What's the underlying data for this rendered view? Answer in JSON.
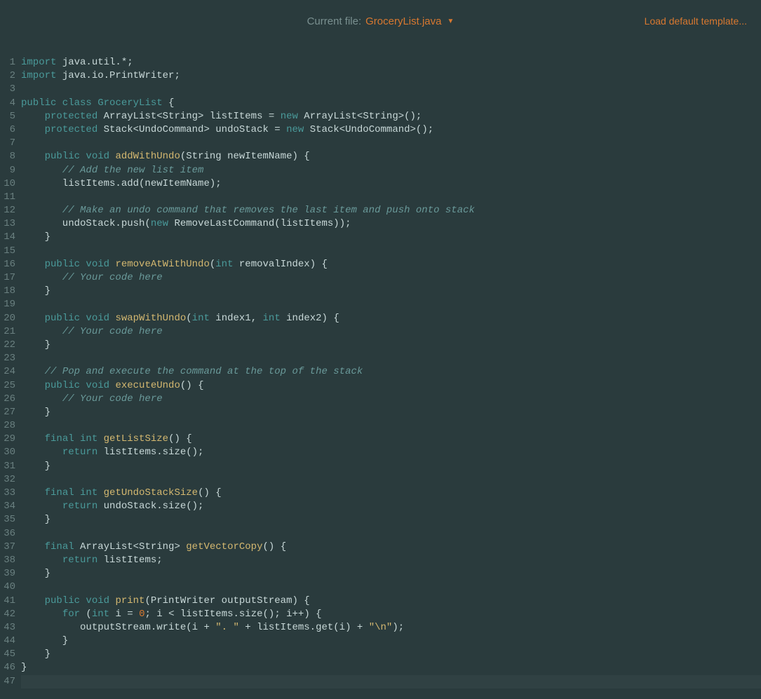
{
  "header": {
    "currentFileLabel": "Current file:",
    "currentFileName": "GroceryList.java",
    "loadTemplate": "Load default template..."
  },
  "code": {
    "lines": [
      [
        {
          "t": "import",
          "c": "kw"
        },
        {
          "t": " java.util.*;",
          "c": "plain"
        }
      ],
      [
        {
          "t": "import",
          "c": "kw"
        },
        {
          "t": " java.io.PrintWriter;",
          "c": "plain"
        }
      ],
      [],
      [
        {
          "t": "public class",
          "c": "kw"
        },
        {
          "t": " ",
          "c": "plain"
        },
        {
          "t": "GroceryList",
          "c": "type"
        },
        {
          "t": " {",
          "c": "plain"
        }
      ],
      [
        {
          "t": "    ",
          "c": "plain"
        },
        {
          "t": "protected",
          "c": "kw"
        },
        {
          "t": " ArrayList<String> listItems = ",
          "c": "plain"
        },
        {
          "t": "new",
          "c": "kw"
        },
        {
          "t": " ArrayList<String>();",
          "c": "plain"
        }
      ],
      [
        {
          "t": "    ",
          "c": "plain"
        },
        {
          "t": "protected",
          "c": "kw"
        },
        {
          "t": " Stack<UndoCommand> undoStack = ",
          "c": "plain"
        },
        {
          "t": "new",
          "c": "kw"
        },
        {
          "t": " Stack<UndoCommand>();",
          "c": "plain"
        }
      ],
      [],
      [
        {
          "t": "    ",
          "c": "plain"
        },
        {
          "t": "public void",
          "c": "kw"
        },
        {
          "t": " ",
          "c": "plain"
        },
        {
          "t": "addWithUndo",
          "c": "method"
        },
        {
          "t": "(String newItemName) {",
          "c": "plain"
        }
      ],
      [
        {
          "t": "       ",
          "c": "plain"
        },
        {
          "t": "// Add the new list item",
          "c": "comment"
        }
      ],
      [
        {
          "t": "       listItems.add(newItemName);",
          "c": "plain"
        }
      ],
      [],
      [
        {
          "t": "       ",
          "c": "plain"
        },
        {
          "t": "// Make an undo command that removes the last item and push onto stack",
          "c": "comment"
        }
      ],
      [
        {
          "t": "       undoStack.push(",
          "c": "plain"
        },
        {
          "t": "new",
          "c": "kw"
        },
        {
          "t": " RemoveLastCommand(listItems));",
          "c": "plain"
        }
      ],
      [
        {
          "t": "    }",
          "c": "plain"
        }
      ],
      [],
      [
        {
          "t": "    ",
          "c": "plain"
        },
        {
          "t": "public void",
          "c": "kw"
        },
        {
          "t": " ",
          "c": "plain"
        },
        {
          "t": "removeAtWithUndo",
          "c": "method"
        },
        {
          "t": "(",
          "c": "plain"
        },
        {
          "t": "int",
          "c": "kw"
        },
        {
          "t": " removalIndex) {",
          "c": "plain"
        }
      ],
      [
        {
          "t": "       ",
          "c": "plain"
        },
        {
          "t": "// Your code here",
          "c": "comment"
        }
      ],
      [
        {
          "t": "    }",
          "c": "plain"
        }
      ],
      [],
      [
        {
          "t": "    ",
          "c": "plain"
        },
        {
          "t": "public void",
          "c": "kw"
        },
        {
          "t": " ",
          "c": "plain"
        },
        {
          "t": "swapWithUndo",
          "c": "method"
        },
        {
          "t": "(",
          "c": "plain"
        },
        {
          "t": "int",
          "c": "kw"
        },
        {
          "t": " index1, ",
          "c": "plain"
        },
        {
          "t": "int",
          "c": "kw"
        },
        {
          "t": " index2) {",
          "c": "plain"
        }
      ],
      [
        {
          "t": "       ",
          "c": "plain"
        },
        {
          "t": "// Your code here",
          "c": "comment"
        }
      ],
      [
        {
          "t": "    }",
          "c": "plain"
        }
      ],
      [],
      [
        {
          "t": "    ",
          "c": "plain"
        },
        {
          "t": "// Pop and execute the command at the top of the stack",
          "c": "comment"
        }
      ],
      [
        {
          "t": "    ",
          "c": "plain"
        },
        {
          "t": "public void",
          "c": "kw"
        },
        {
          "t": " ",
          "c": "plain"
        },
        {
          "t": "executeUndo",
          "c": "method"
        },
        {
          "t": "() {",
          "c": "plain"
        }
      ],
      [
        {
          "t": "       ",
          "c": "plain"
        },
        {
          "t": "// Your code here",
          "c": "comment"
        }
      ],
      [
        {
          "t": "    }",
          "c": "plain"
        }
      ],
      [],
      [
        {
          "t": "    ",
          "c": "plain"
        },
        {
          "t": "final int",
          "c": "kw"
        },
        {
          "t": " ",
          "c": "plain"
        },
        {
          "t": "getListSize",
          "c": "method"
        },
        {
          "t": "() {",
          "c": "plain"
        }
      ],
      [
        {
          "t": "       ",
          "c": "plain"
        },
        {
          "t": "return",
          "c": "kw"
        },
        {
          "t": " listItems.size();",
          "c": "plain"
        }
      ],
      [
        {
          "t": "    }",
          "c": "plain"
        }
      ],
      [],
      [
        {
          "t": "    ",
          "c": "plain"
        },
        {
          "t": "final int",
          "c": "kw"
        },
        {
          "t": " ",
          "c": "plain"
        },
        {
          "t": "getUndoStackSize",
          "c": "method"
        },
        {
          "t": "() {",
          "c": "plain"
        }
      ],
      [
        {
          "t": "       ",
          "c": "plain"
        },
        {
          "t": "return",
          "c": "kw"
        },
        {
          "t": " undoStack.size();",
          "c": "plain"
        }
      ],
      [
        {
          "t": "    }",
          "c": "plain"
        }
      ],
      [],
      [
        {
          "t": "    ",
          "c": "plain"
        },
        {
          "t": "final",
          "c": "kw"
        },
        {
          "t": " ArrayList<String> ",
          "c": "plain"
        },
        {
          "t": "getVectorCopy",
          "c": "method"
        },
        {
          "t": "() {",
          "c": "plain"
        }
      ],
      [
        {
          "t": "       ",
          "c": "plain"
        },
        {
          "t": "return",
          "c": "kw"
        },
        {
          "t": " listItems;",
          "c": "plain"
        }
      ],
      [
        {
          "t": "    }",
          "c": "plain"
        }
      ],
      [],
      [
        {
          "t": "    ",
          "c": "plain"
        },
        {
          "t": "public void",
          "c": "kw"
        },
        {
          "t": " ",
          "c": "plain"
        },
        {
          "t": "print",
          "c": "method"
        },
        {
          "t": "(PrintWriter outputStream) {",
          "c": "plain"
        }
      ],
      [
        {
          "t": "       ",
          "c": "plain"
        },
        {
          "t": "for",
          "c": "kw"
        },
        {
          "t": " (",
          "c": "plain"
        },
        {
          "t": "int",
          "c": "kw"
        },
        {
          "t": " i = ",
          "c": "plain"
        },
        {
          "t": "0",
          "c": "num"
        },
        {
          "t": "; i < listItems.size(); i++) {",
          "c": "plain"
        }
      ],
      [
        {
          "t": "          outputStream.write(i + ",
          "c": "plain"
        },
        {
          "t": "\". \"",
          "c": "string"
        },
        {
          "t": " + listItems.get(i) + ",
          "c": "plain"
        },
        {
          "t": "\"\\n\"",
          "c": "string"
        },
        {
          "t": ");",
          "c": "plain"
        }
      ],
      [
        {
          "t": "       }",
          "c": "plain"
        }
      ],
      [
        {
          "t": "    }",
          "c": "plain"
        }
      ],
      [
        {
          "t": "}",
          "c": "plain"
        }
      ],
      []
    ]
  }
}
